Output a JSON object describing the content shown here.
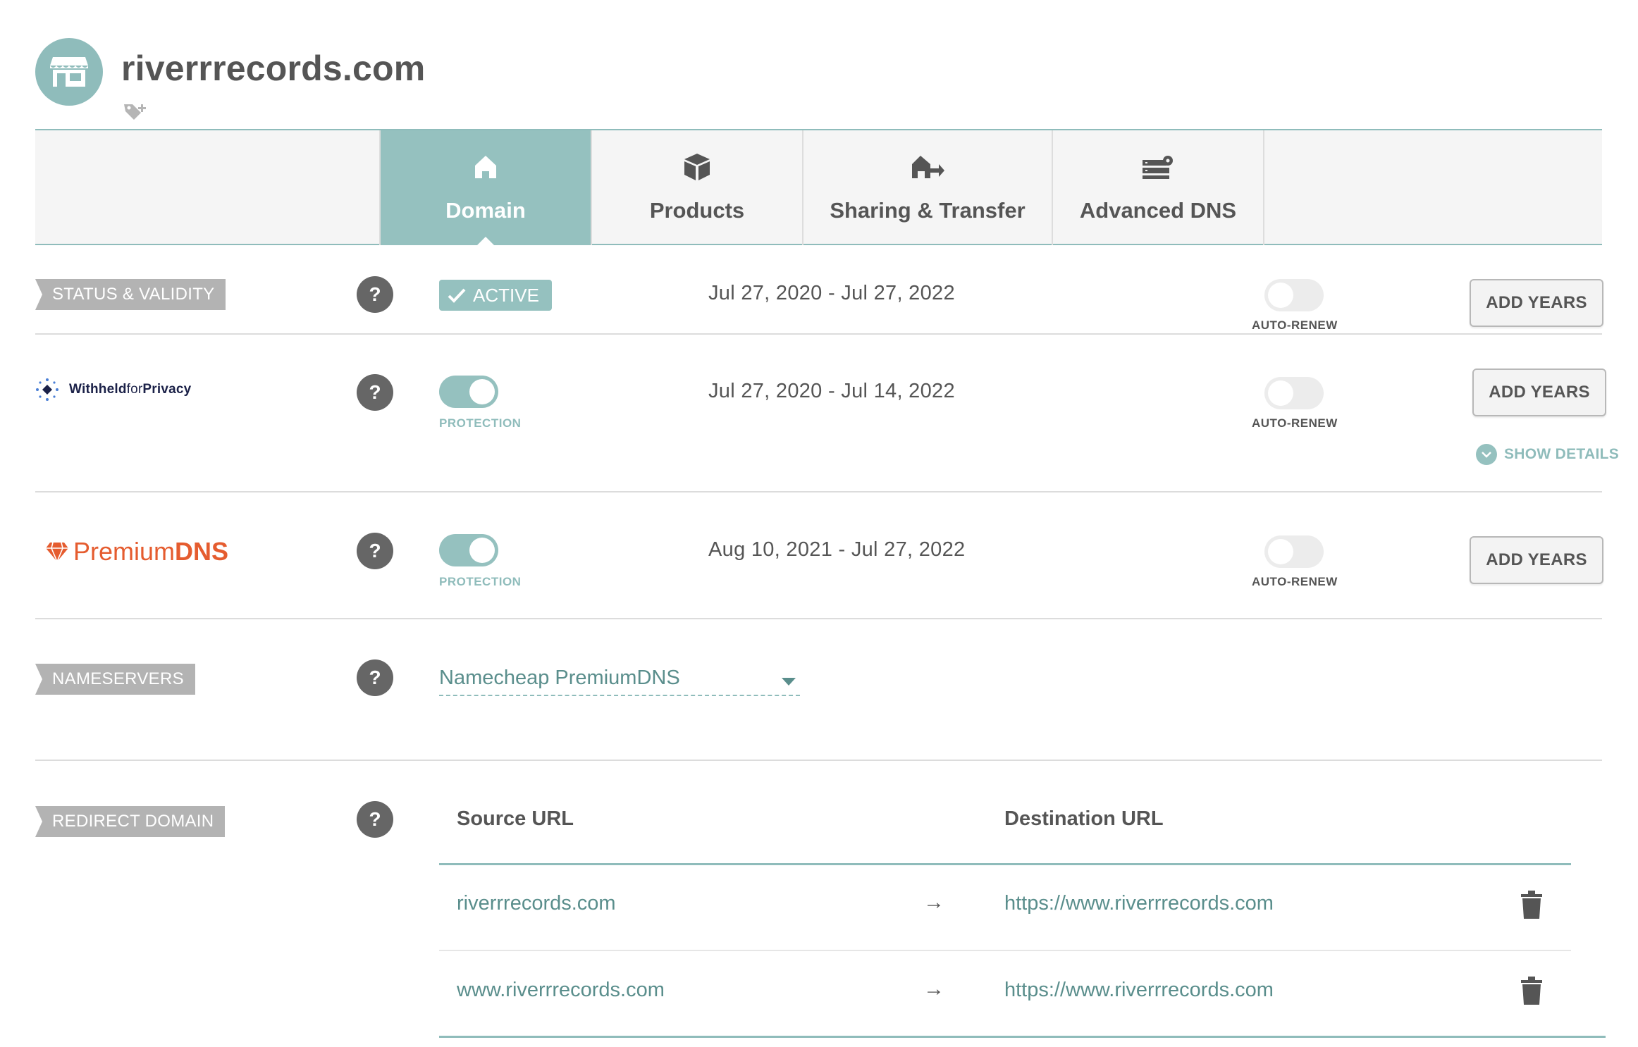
{
  "header": {
    "domain": "riverrrecords.com",
    "avatar_icon": "store-icon",
    "tag_icon": "tag-plus-icon"
  },
  "tabs": [
    {
      "label": "Domain",
      "icon": "home-icon",
      "active": true
    },
    {
      "label": "Products",
      "icon": "box-icon",
      "active": false
    },
    {
      "label": "Sharing & Transfer",
      "icon": "house-arrow-icon",
      "active": false
    },
    {
      "label": "Advanced DNS",
      "icon": "server-gear-icon",
      "active": false
    }
  ],
  "status": {
    "section_label": "STATUS & VALIDITY",
    "badge": "ACTIVE",
    "dates": "Jul 27, 2020 - Jul 27, 2022",
    "auto_renew_label": "AUTO-RENEW",
    "auto_renew_on": false,
    "button": "ADD YEARS"
  },
  "privacy": {
    "logo_part1": "Withheld",
    "logo_part2": "for",
    "logo_part3": "Privacy",
    "protection_label": "PROTECTION",
    "protection_on": true,
    "dates": "Jul 27, 2020 - Jul 14, 2022",
    "auto_renew_label": "AUTO-RENEW",
    "auto_renew_on": false,
    "button": "ADD YEARS",
    "show_details": "SHOW DETAILS"
  },
  "premiumdns": {
    "logo_part1": "Premium",
    "logo_part2": "DNS",
    "protection_label": "PROTECTION",
    "protection_on": true,
    "dates": "Aug 10, 2021 - Jul 27, 2022",
    "auto_renew_label": "AUTO-RENEW",
    "auto_renew_on": false,
    "button": "ADD YEARS"
  },
  "nameservers": {
    "section_label": "NAMESERVERS",
    "value": "Namecheap PremiumDNS"
  },
  "redirect": {
    "section_label": "REDIRECT DOMAIN",
    "col_source": "Source URL",
    "col_dest": "Destination URL",
    "arrow": "→",
    "rows": [
      {
        "source": "riverrrecords.com",
        "destination": "https://www.riverrrecords.com"
      },
      {
        "source": "www.riverrrecords.com",
        "destination": "https://www.riverrrecords.com"
      }
    ]
  },
  "help_symbol": "?",
  "colors": {
    "accent": "#95c1bf",
    "text": "#555555",
    "link": "#5a8e8c",
    "ribbon": "#b3b3b3",
    "premium": "#e55c2f",
    "privacy": "#1b2148"
  }
}
